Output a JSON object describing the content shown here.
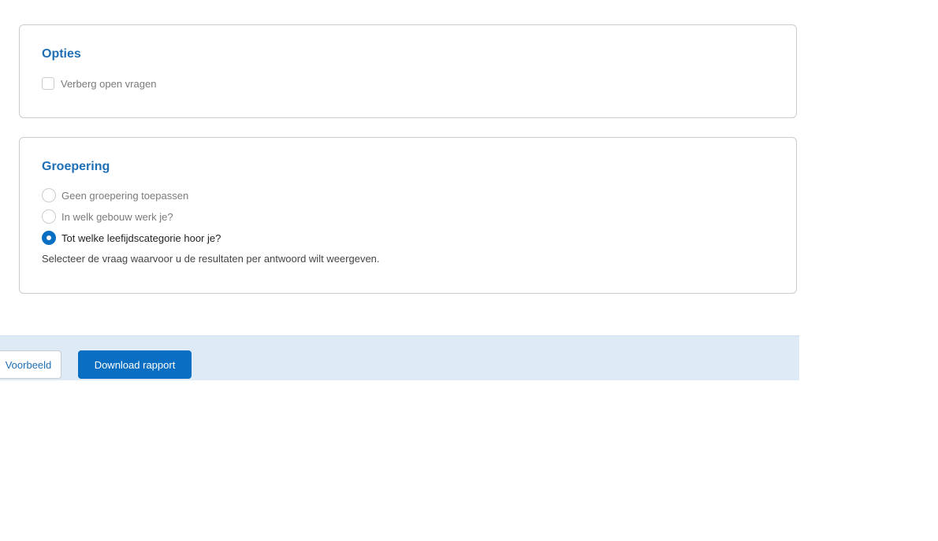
{
  "options": {
    "title": "Opties",
    "hide_open_questions": {
      "label": "Verberg open vragen",
      "checked": false
    }
  },
  "grouping": {
    "title": "Groepering",
    "choices": [
      {
        "label": "Geen groepering toepassen",
        "selected": false
      },
      {
        "label": "In welk gebouw werk je?",
        "selected": false
      },
      {
        "label": "Tot welke leefijdscategorie hoor je?",
        "selected": true
      }
    ],
    "helper": "Selecteer de vraag waarvoor u de resultaten per antwoord wilt weergeven."
  },
  "footer": {
    "preview_label": "Voorbeeld",
    "download_label": "Download rapport"
  },
  "colors": {
    "accent": "#0a6fc2",
    "title": "#1f6fb5",
    "footer_bg": "#deebf7"
  }
}
